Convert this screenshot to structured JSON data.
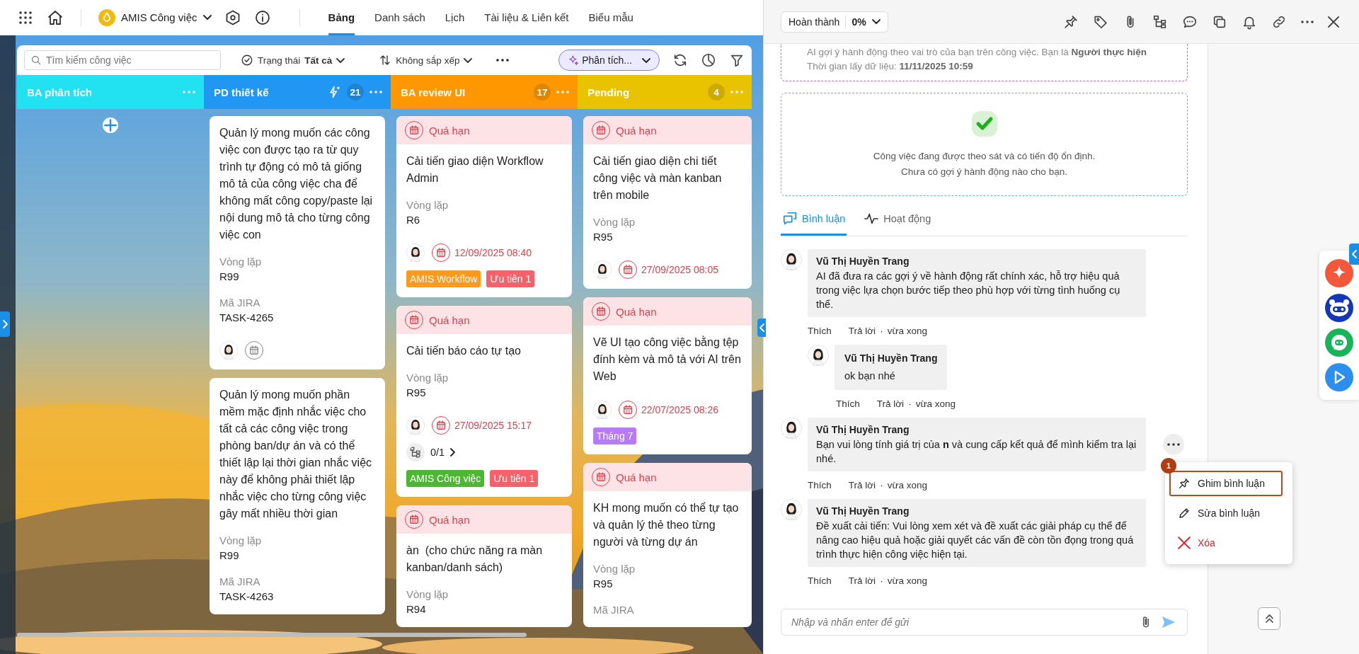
{
  "nav": {
    "project": "AMIS Công việc",
    "tabs": [
      {
        "label": "Bảng",
        "selected": true
      },
      {
        "label": "Danh sách",
        "selected": false
      },
      {
        "label": "Lịch",
        "selected": false
      },
      {
        "label": "Tài liệu & Liên kết",
        "selected": false
      },
      {
        "label": "Biểu mẫu",
        "selected": false
      }
    ]
  },
  "toolbar": {
    "search": {
      "placeholder": "Tìm kiếm công việc"
    },
    "status": {
      "label": "Trạng thái",
      "value": "Tất cả"
    },
    "sort": {
      "label": "Không sắp xếp"
    },
    "analysis": {
      "label": "Phân tích..."
    }
  },
  "columns": [
    {
      "title": "BA phân tích",
      "color": "#22e1f1",
      "add_button": true
    },
    {
      "title": "PD thiết kế",
      "color": "#2196f3",
      "ai_icon": true,
      "count": "21",
      "cards": [
        {
          "title": "Quản lý mong muốn các công việc con được tạo ra từ quy trình tự động có mô tả giống mô tả của công việc cha để không mất công copy/paste lại nội dung mô tả cho từng công việc con",
          "fields": [
            {
              "label": "Vòng lặp",
              "value": "R99"
            },
            {
              "label": "Mã JIRA",
              "value": "TASK-4265"
            }
          ],
          "assignee": true,
          "due": {
            "kind": "unset"
          }
        },
        {
          "title": "Quản lý mong muốn phần mềm mặc định nhắc việc cho tất cả các công việc trong phòng ban/dự án và có thể thiết lập lại thời gian nhắc việc này để không phải thiết lập nhắc việc cho từng công việc gây mất nhiều thời gian",
          "fields": [
            {
              "label": "Vòng lặp",
              "value": "R99"
            },
            {
              "label": "Mã JIRA",
              "value": "TASK-4263"
            }
          ]
        }
      ]
    },
    {
      "title": "BA review UI",
      "color": "#ff9800",
      "count": "17",
      "cards": [
        {
          "banner": {
            "kind": "overdue",
            "label": "Quá hạn"
          },
          "title": "Cải tiến giao diện Workflow Admin",
          "fields": [
            {
              "label": "Vòng lặp",
              "value": "R6"
            }
          ],
          "assignee": true,
          "due": {
            "kind": "overdue",
            "date": "12/09/2025 08:40"
          },
          "tags": [
            {
              "label": "AMIS Workflow",
              "color": "#ff9a1f"
            },
            {
              "label": "Ưu tiên 1",
              "color": "#f7626a"
            }
          ]
        },
        {
          "banner": {
            "kind": "overdue",
            "label": "Quá hạn"
          },
          "title": "Cải tiến báo cáo tự tạo",
          "fields": [
            {
              "label": "Vòng lặp",
              "value": "R95"
            }
          ],
          "assignee": true,
          "due": {
            "kind": "overdue",
            "date": "27/09/2025 15:17"
          },
          "subtasks": "0/1",
          "tags": [
            {
              "label": "AMIS Công việc",
              "color": "#4cb831"
            },
            {
              "label": "Ưu tiên 1",
              "color": "#f7626a"
            }
          ]
        },
        {
          "banner": {
            "kind": "overdue",
            "label": "Quá hạn"
          },
          "title": "àn  (cho chức năng ra màn kanban/danh sách)",
          "fields": [
            {
              "label": "Vòng lặp",
              "value": "R94"
            }
          ]
        }
      ]
    },
    {
      "title": "Pending",
      "color": "#e9c200",
      "count": "4",
      "cards": [
        {
          "banner": {
            "kind": "overdue",
            "label": "Quá hạn"
          },
          "title": "Cải tiến giao diện chi tiết công việc và màn kanban trên mobile",
          "fields": [
            {
              "label": "Vòng lặp",
              "value": "R95"
            }
          ],
          "assignee": true,
          "due": {
            "kind": "overdue",
            "date": "27/09/2025 08:05"
          }
        },
        {
          "banner": {
            "kind": "overdue",
            "label": "Quá hạn"
          },
          "title": "Vẽ UI tạo công việc bằng tệp đính kèm và mô tả với AI trên Web",
          "assignee": true,
          "due": {
            "kind": "overdue",
            "date": "22/07/2025 08:26"
          },
          "tags": [
            {
              "label": "Tháng 7",
              "color": "#b57cf5"
            }
          ]
        },
        {
          "banner": {
            "kind": "overdue",
            "label": "Quá hạn"
          },
          "title": "KH mong muốn có thể tự tạo và quản lý thẻ theo từng người và từng dự án",
          "fields": [
            {
              "label": "Vòng lặp",
              "value": "R95"
            },
            {
              "label": "Mã JIRA"
            }
          ]
        }
      ]
    }
  ],
  "detail": {
    "progress": {
      "label": "Hoàn thành",
      "value": "0%"
    },
    "ai_note": [
      "AI gợi ý hành động theo vai trò của bạn trên công việc. Bạn là **Người thực hiện**",
      "Thời gian lấy dữ liệu: **11/11/2025 10:59**"
    ],
    "status_box": [
      "Công việc đang được theo sát và có tiến độ ổn định.",
      "Chưa có gợi ý hành động nào cho bạn."
    ],
    "tabs": [
      {
        "label": "Bình luận",
        "kind": "comments",
        "selected": true
      },
      {
        "label": "Hoạt động",
        "kind": "activity",
        "selected": false
      }
    ],
    "comments": [
      {
        "author": "Vũ Thị Huyền Trang",
        "text": "AI đã đưa ra các gợi ý về hành động rất chính xác, hỗ trợ hiệu quả trong việc lựa chọn bước tiếp theo phù hợp với từng tình huống cụ thể.",
        "like": "Thích",
        "reply": "Trả lời",
        "dot": "·",
        "time": "vừa xong",
        "replies": [
          {
            "author": "Vũ Thị Huyền Trang",
            "text": "ok bạn nhé",
            "like": "Thích",
            "reply": "Trả lời",
            "dot": "·",
            "time": "vừa xong"
          }
        ]
      },
      {
        "author": "Vũ Thị Huyền Trang",
        "text": "Bạn vui lòng tính giá trị của **n** và cung cấp kết quả để mình kiểm tra lại nhé.",
        "like": "Thích",
        "reply": "Trả lời",
        "dot": "·",
        "time": "vừa xong",
        "menu": {
          "badge": "1",
          "items": [
            {
              "kind": "pin",
              "label": "Ghim bình luận",
              "selected": true
            },
            {
              "kind": "edit",
              "label": "Sửa bình luận",
              "selected": false
            },
            {
              "kind": "delete",
              "label": "Xóa",
              "selected": false
            }
          ]
        }
      },
      {
        "author": "Vũ Thị Huyền Trang",
        "text": "Đề xuất cải tiến: Vui lòng xem xét và đề xuất các giải pháp cụ thể để nâng cao hiệu quả hoặc giải quyết các vấn đề còn tồn đọng trong quá trình thực hiện công việc hiện tại.",
        "like": "Thích",
        "reply": "Trả lời",
        "dot": "·",
        "time": "vừa xong"
      }
    ],
    "composer": {
      "placeholder": "Nhập và nhấn enter để gửi"
    }
  }
}
